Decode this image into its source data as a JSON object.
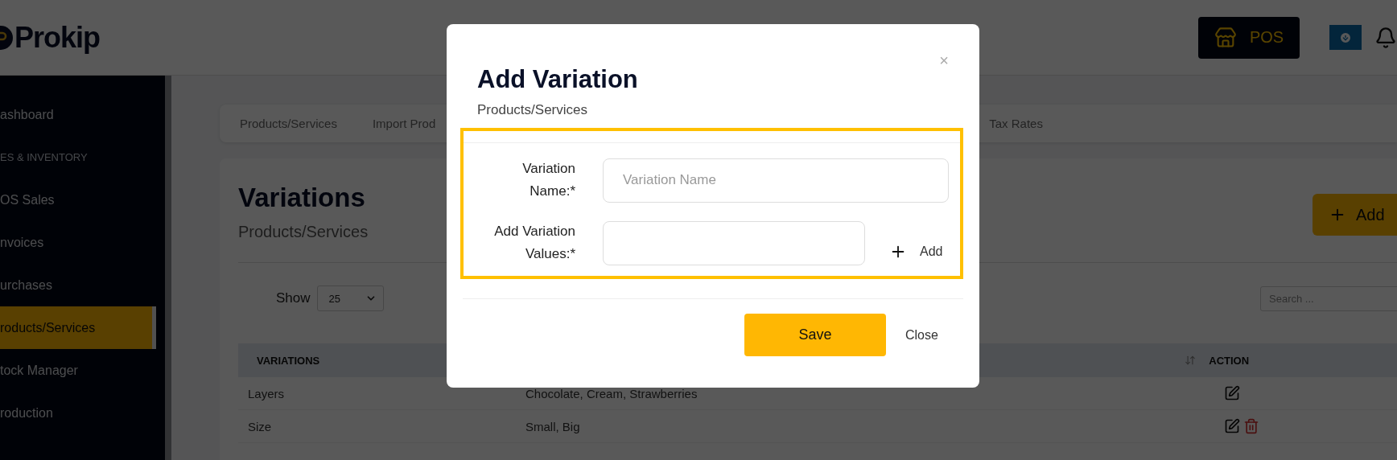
{
  "header": {
    "logo": "Prokip",
    "pos_button": "POS"
  },
  "sidebar": {
    "items": [
      {
        "label": "ashboard",
        "kind": "item",
        "selected": false
      },
      {
        "label": "ES & INVENTORY",
        "kind": "section",
        "selected": false
      },
      {
        "label": "OS Sales",
        "kind": "item",
        "selected": false
      },
      {
        "label": "nvoices",
        "kind": "item",
        "selected": false
      },
      {
        "label": "urchases",
        "kind": "item",
        "selected": false
      },
      {
        "label": "roducts/Services",
        "kind": "item",
        "selected": true
      },
      {
        "label": "tock Manager",
        "kind": "item",
        "selected": false
      },
      {
        "label": "roduction",
        "kind": "item",
        "selected": false
      }
    ]
  },
  "tabs": [
    {
      "label": "Products/Services"
    },
    {
      "label": "Import Prod"
    },
    {
      "label": "Tax Rates"
    }
  ],
  "page": {
    "title": "Variations",
    "subtitle": "Products/Services",
    "add_button": "Add"
  },
  "table_controls": {
    "show_label": "Show",
    "page_size": "25",
    "search_placeholder": "Search ..."
  },
  "table": {
    "columns": [
      "VARIATIONS",
      "ACTION"
    ],
    "rows": [
      {
        "variation": "Layers",
        "values": "Chocolate, Cream, Strawberries",
        "deletable": false
      },
      {
        "variation": "Size",
        "values": "Small, Big",
        "deletable": true
      }
    ]
  },
  "modal": {
    "title": "Add Variation",
    "subtitle": "Products/Services",
    "close_icon": "×",
    "highlighted": true,
    "fields": [
      {
        "kind": "text",
        "label": "Variation Name:*",
        "placeholder": "Variation Name"
      },
      {
        "kind": "values",
        "label": "Add Variation Values:*",
        "add_label": "Add"
      }
    ],
    "save_button": "Save",
    "close_button": "Close"
  }
}
